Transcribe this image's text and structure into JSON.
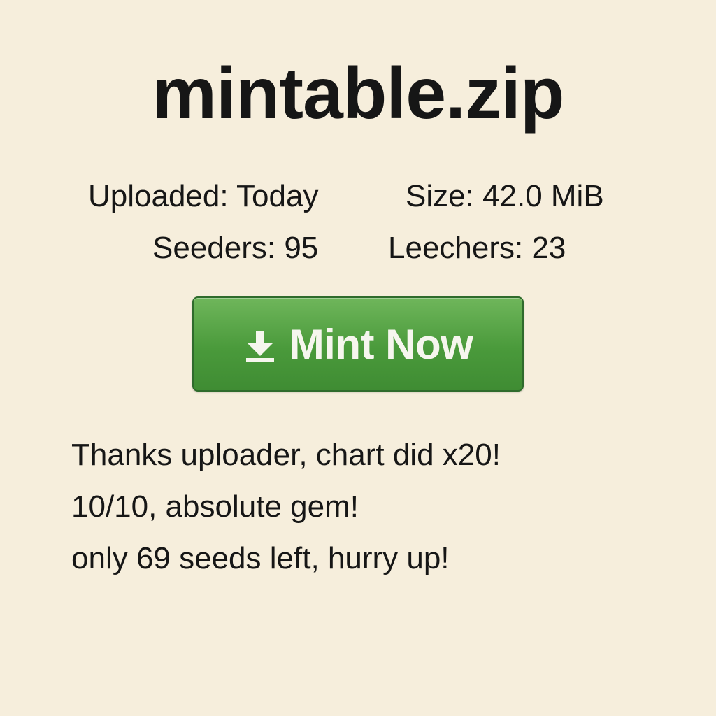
{
  "file": {
    "title": "mintable.zip"
  },
  "meta": {
    "uploaded": "Uploaded: Today",
    "size": "Size: 42.0 MiB",
    "seeders": "Seeders: 95",
    "leechers": "Leechers: 23"
  },
  "action": {
    "label": "Mint Now",
    "icon": "download-icon",
    "color": "#4a9a3b"
  },
  "comments": [
    "Thanks uploader, chart did x20!",
    "10/10, absolute gem!",
    "only 69 seeds left, hurry up!"
  ]
}
